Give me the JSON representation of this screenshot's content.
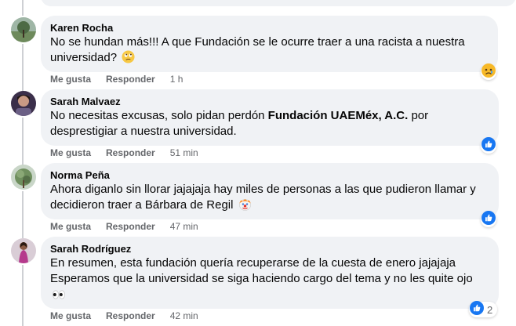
{
  "comments": [
    {
      "author": "Karen Rocha",
      "text_parts": [
        "No se hundan más!!! A que Fundación se le ocurre traer a una racista a nuestra universidad? "
      ],
      "emoji": "rolling-eyes-emoji",
      "like_label": "Me gusta",
      "reply_label": "Responder",
      "time": "1 h",
      "reaction": "sad-reaction-icon"
    },
    {
      "author": "Sarah Malvaez",
      "text_pre": "No necesitas excusas, solo pidan perdón ",
      "text_bold": "Fundación UAEMéx, A.C.",
      "text_post": " por desprestigiar a nuestra universidad.",
      "like_label": "Me gusta",
      "reply_label": "Responder",
      "time": "51 min",
      "reaction": "like-reaction-icon"
    },
    {
      "author": "Norma Peña",
      "text": "Ahora diganlo sin llorar jajajaja hay miles de personas a las que pudieron llamar y decidieron traer a Bárbara de Regil ",
      "emoji": "clown-face-emoji",
      "like_label": "Me gusta",
      "reply_label": "Responder",
      "time": "47 min",
      "reaction": "like-reaction-icon"
    },
    {
      "author": "Sarah Rodríguez",
      "text": "En resumen, esta fundación quería recuperarse de la cuesta de enero jajajaja Esperamos que la universidad se siga haciendo cargo del tema y no les quite ojo ",
      "emoji": "eyes-emoji",
      "like_label": "Me gusta",
      "reply_label": "Responder",
      "time": "42 min",
      "reaction": "like-reaction-icon",
      "reaction_count": "2"
    }
  ],
  "colors": {
    "bubble": "#f0f2f5",
    "meta": "#65676b",
    "like_blue": "#1877f2",
    "text": "#050505"
  }
}
